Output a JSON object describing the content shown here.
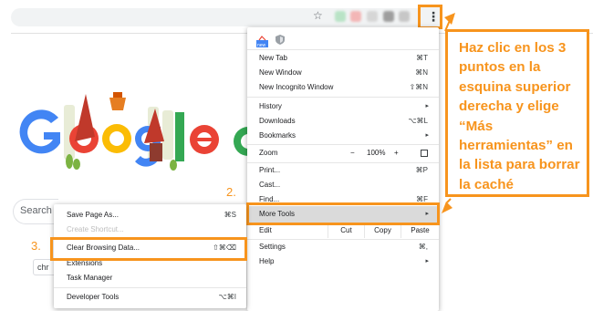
{
  "browser": {
    "menu_button_glyph": "⋮",
    "star_glyph": "☆",
    "extension_colors": [
      "#b9e3c6",
      "#f3b6b6",
      "#d6d6d6",
      "#9e9e9e",
      "#c7c7c7",
      "#e0b0b0"
    ]
  },
  "page": {
    "search_placeholder": "Search G",
    "chip_text": "chr"
  },
  "main_menu": {
    "items": {
      "new_tab": {
        "label": "New Tab",
        "shortcut": "⌘T"
      },
      "new_window": {
        "label": "New Window",
        "shortcut": "⌘N"
      },
      "new_incognito": {
        "label": "New Incognito Window",
        "shortcut": "⇧⌘N"
      },
      "history": {
        "label": "History",
        "arrow": "▸"
      },
      "downloads": {
        "label": "Downloads",
        "shortcut": "⌥⌘L"
      },
      "bookmarks": {
        "label": "Bookmarks",
        "arrow": "▸"
      },
      "zoom": {
        "label": "Zoom",
        "minus": "−",
        "value": "100%",
        "plus": "+"
      },
      "print": {
        "label": "Print...",
        "shortcut": "⌘P"
      },
      "cast": {
        "label": "Cast..."
      },
      "find": {
        "label": "Find...",
        "shortcut": "⌘F"
      },
      "more_tools": {
        "label": "More Tools",
        "arrow": "▸"
      },
      "edit": {
        "label": "Edit",
        "cut": "Cut",
        "copy": "Copy",
        "paste": "Paste"
      },
      "settings": {
        "label": "Settings",
        "shortcut": "⌘,"
      },
      "help": {
        "label": "Help",
        "arrow": "▸"
      }
    },
    "icons": {
      "new_badge": "new"
    }
  },
  "submenu": {
    "items": {
      "save_page": {
        "label": "Save Page As...",
        "shortcut": "⌘S"
      },
      "create_shortcut": {
        "label": "Create Shortcut..."
      },
      "clear_browsing": {
        "label": "Clear Browsing Data...",
        "shortcut": "⇧⌘⌫"
      },
      "extensions": {
        "label": "Extensions"
      },
      "task_manager": {
        "label": "Task Manager"
      },
      "developer_tools": {
        "label": "Developer Tools",
        "shortcut": "⌥⌘I"
      }
    }
  },
  "annotations": {
    "step2": "2.",
    "step3": "3.",
    "callout_text": "Haz clic en los 3 puntos en la esquina superior derecha y elige “Más herramientas” en la lista para borrar la caché",
    "accent_color": "#f7941d"
  }
}
